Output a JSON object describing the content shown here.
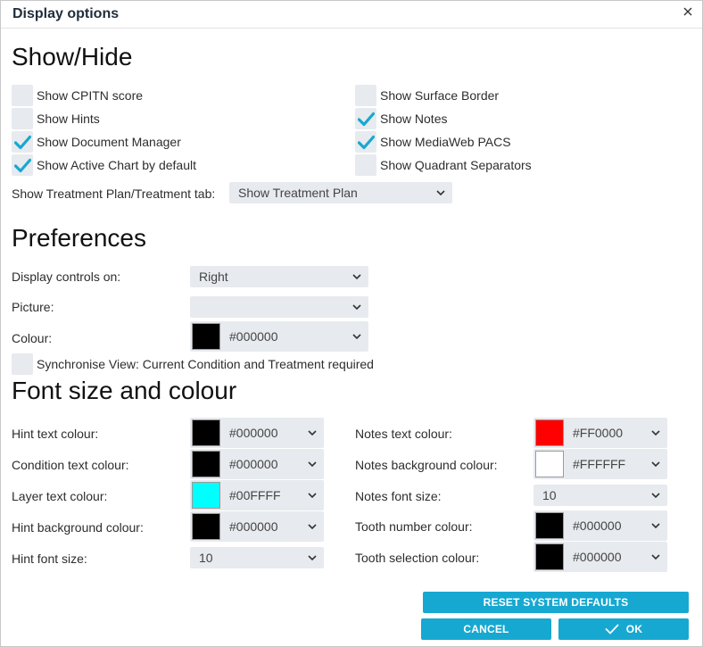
{
  "dialog": {
    "title": "Display options"
  },
  "icons": {
    "close": "close-icon",
    "check": "checkmark-icon",
    "chevron": "chevron-down-icon"
  },
  "colors": {
    "accent": "#17a8d1",
    "check": "#17a8d1",
    "field_bg": "#e7eaee"
  },
  "show_hide": {
    "heading": "Show/Hide",
    "left": [
      {
        "label": "Show CPITN score",
        "checked": false
      },
      {
        "label": "Show Hints",
        "checked": false
      },
      {
        "label": "Show Document Manager",
        "checked": true
      },
      {
        "label": "Show Active Chart by default",
        "checked": true
      }
    ],
    "right": [
      {
        "label": "Show Surface Border",
        "checked": false
      },
      {
        "label": "Show Notes",
        "checked": true
      },
      {
        "label": "Show MediaWeb PACS",
        "checked": true
      },
      {
        "label": "Show Quadrant Separators",
        "checked": false
      }
    ],
    "treatment_tab": {
      "label": "Show Treatment Plan/Treatment tab:",
      "value": "Show Treatment Plan"
    }
  },
  "preferences": {
    "heading": "Preferences",
    "display_controls": {
      "label": "Display controls on:",
      "value": "Right"
    },
    "picture": {
      "label": "Picture:",
      "value": ""
    },
    "colour": {
      "label": "Colour:",
      "value": "#000000",
      "swatch": "#000000"
    },
    "synchronise": {
      "label": "Synchronise View: Current Condition and Treatment required",
      "checked": false
    }
  },
  "font": {
    "heading": "Font size and colour",
    "left": [
      {
        "label": "Hint text colour:",
        "kind": "colour",
        "value": "#000000",
        "swatch": "#000000"
      },
      {
        "label": "Condition text colour:",
        "kind": "colour",
        "value": "#000000",
        "swatch": "#000000"
      },
      {
        "label": "Layer text colour:",
        "kind": "colour",
        "value": "#00FFFF",
        "swatch": "#00FFFF"
      },
      {
        "label": "Hint background colour:",
        "kind": "colour",
        "value": "#000000",
        "swatch": "#000000"
      },
      {
        "label": "Hint font size:",
        "kind": "select",
        "value": "10"
      }
    ],
    "right": [
      {
        "label": "Notes text colour:",
        "kind": "colour",
        "value": "#FF0000",
        "swatch": "#FF0000"
      },
      {
        "label": "Notes background colour:",
        "kind": "colour",
        "value": "#FFFFFF",
        "swatch": "#FFFFFF"
      },
      {
        "label": "Notes font size:",
        "kind": "select",
        "value": "10"
      },
      {
        "label": "Tooth number colour:",
        "kind": "colour",
        "value": "#000000",
        "swatch": "#000000"
      },
      {
        "label": "Tooth selection colour:",
        "kind": "colour",
        "value": "#000000",
        "swatch": "#000000"
      }
    ]
  },
  "buttons": {
    "reset": "RESET SYSTEM DEFAULTS",
    "cancel": "CANCEL",
    "ok": "OK"
  }
}
